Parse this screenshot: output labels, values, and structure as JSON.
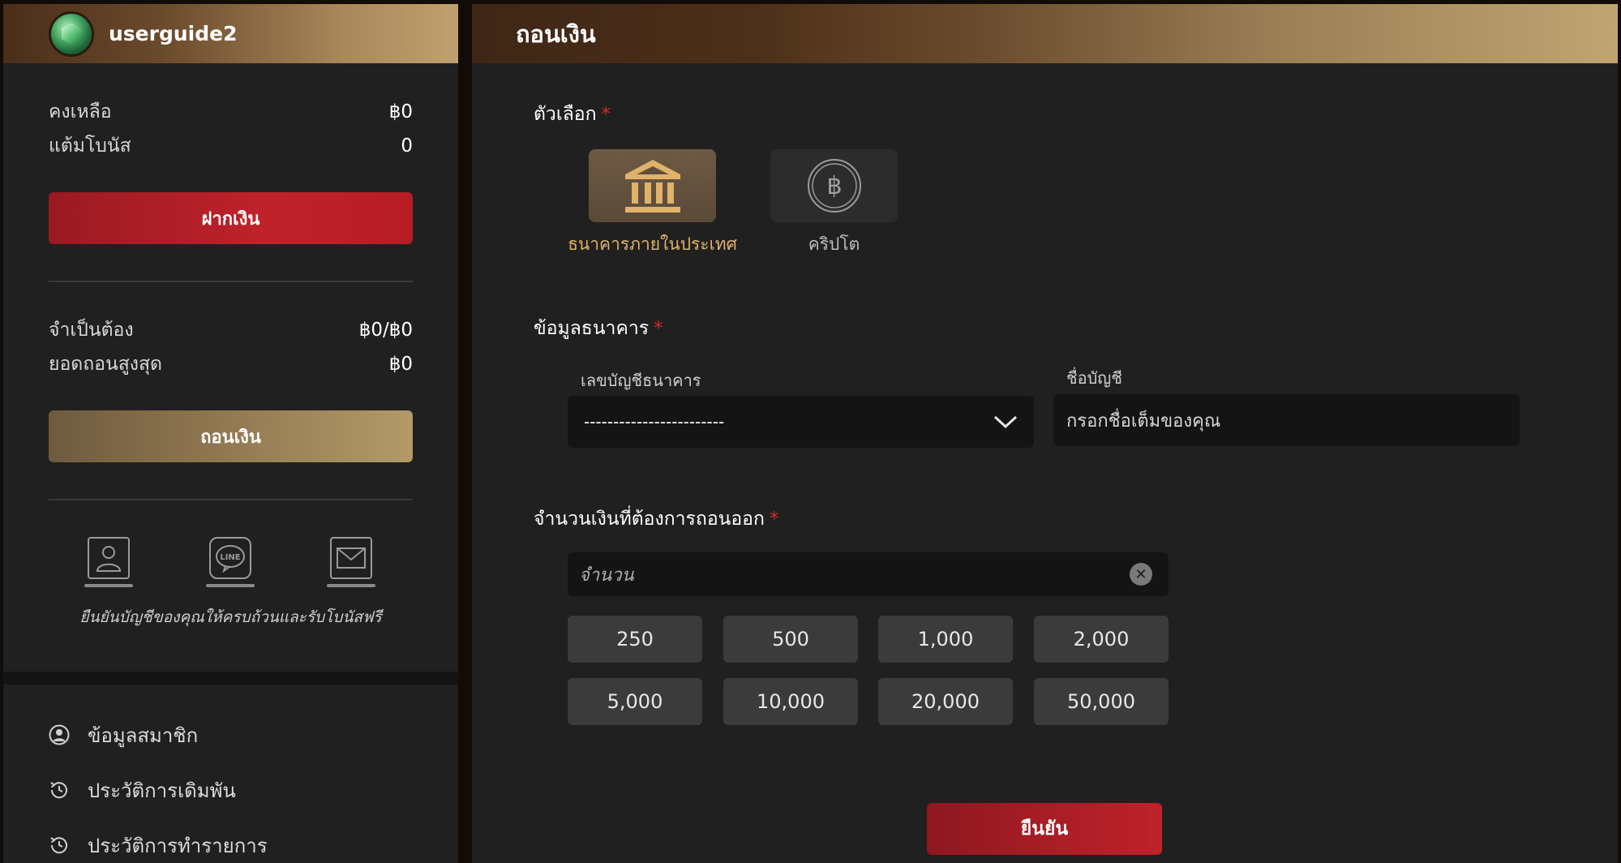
{
  "sidebar": {
    "username": "userguide2",
    "balance_label": "คงเหลือ",
    "balance_value": "฿0",
    "bonus_label": "แต้มโบนัส",
    "bonus_value": "0",
    "deposit_label": "ฝากเงิน",
    "required_label": "จำเป็นต้อง",
    "required_value": "฿0/฿0",
    "max_withdraw_label": "ยอดถอนสูงสุด",
    "max_withdraw_value": "฿0",
    "withdraw_label": "ถอนเงิน",
    "verify_text": "ยืนยันบัญชีของคุณให้ครบถ้วนและรับโบนัสฟรี",
    "verify_icons": [
      "id-card-icon",
      "line-icon",
      "email-icon"
    ],
    "menu": [
      {
        "label": "ข้อมูลสมาชิก",
        "icon": "user-circle-icon"
      },
      {
        "label": "ประวัติการเดิมพัน",
        "icon": "history-icon"
      },
      {
        "label": "ประวัติการทำรายการ",
        "icon": "history-icon"
      }
    ]
  },
  "main": {
    "title": "ถอนเงิน",
    "option_label": "ตัวเลือก",
    "options": [
      {
        "label": "ธนาคารภายในประเทศ",
        "icon": "bank-icon",
        "selected": true
      },
      {
        "label": "คริปโต",
        "icon": "bitcoin-icon",
        "selected": false
      }
    ],
    "bank_info_label": "ข้อมูลธนาคาร",
    "account_number_label": "เลขบัญชีธนาคาร",
    "account_number_value": "------------------------",
    "account_name_label": "ชื่อบัญชี",
    "account_name_placeholder": "กรอกชื่อเต็มของคุณ",
    "amount_label": "จำนวนเงินที่ต้องการถอนออก",
    "amount_placeholder": "จำนวน",
    "quick_amounts": [
      "250",
      "500",
      "1,000",
      "2,000",
      "5,000",
      "10,000",
      "20,000",
      "50,000"
    ],
    "confirm_label": "ยืนยัน",
    "required_mark": "*"
  },
  "colors": {
    "accent_gold": "#e0b26a",
    "button_red": "#c0222a",
    "required_red": "#d32a2a"
  }
}
